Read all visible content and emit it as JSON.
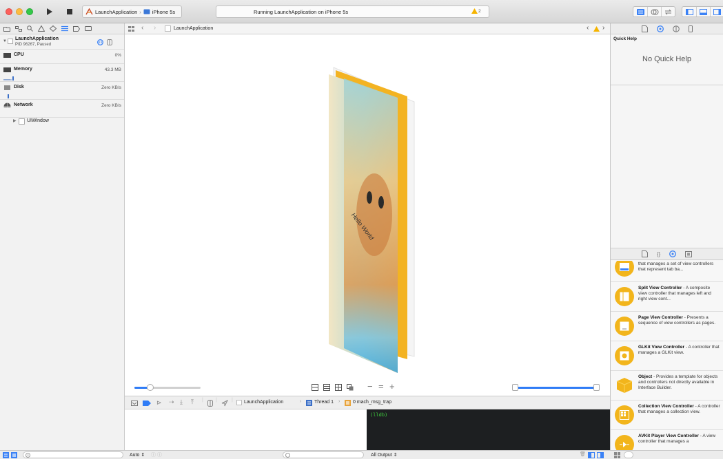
{
  "toolbar": {
    "scheme_name": "LaunchApplication",
    "device_name": "iPhone 5s",
    "activity_status": "Running LaunchApplication on iPhone 5s",
    "warning_count": "2"
  },
  "navigator": {
    "process_name": "LaunchApplication",
    "process_info": "PID 96267, Paused",
    "gauges": [
      {
        "label": "CPU",
        "value": "0%"
      },
      {
        "label": "Memory",
        "value": "43.3 MB"
      },
      {
        "label": "Disk",
        "value": "Zero KB/s"
      },
      {
        "label": "Network",
        "value": "Zero KB/s"
      }
    ],
    "tree_item": "UIWindow"
  },
  "jumpbar": {
    "path_item": "LaunchApplication"
  },
  "canvas": {
    "label_text": "Hello World"
  },
  "inspector": {
    "quick_help_title": "Quick Help",
    "quick_help_empty": "No Quick Help",
    "library_items": [
      {
        "title": "",
        "desc": "that manages a set of view controllers that represent tab ba..."
      },
      {
        "title": "Split View Controller",
        "desc": " - A composite view controller that manages left and right view cont..."
      },
      {
        "title": "Page View Controller",
        "desc": " - Presents a sequence of view controllers as pages."
      },
      {
        "title": "GLKit View Controller",
        "desc": " - A controller that manages a GLKit view."
      },
      {
        "title": "Object",
        "desc": " - Provides a template for objects and controllers not directly available in Interface Builder."
      },
      {
        "title": "Collection View Controller",
        "desc": " - A controller that manages a collection view."
      },
      {
        "title": "AVKit Player View Controller",
        "desc": " - A view controller that manages a"
      }
    ]
  },
  "debug": {
    "breadcrumb_app": "LaunchApplication",
    "breadcrumb_thread": "Thread 1",
    "breadcrumb_frame": "0 mach_msg_trap",
    "console_prompt": "(lldb)",
    "auto_label": "Auto",
    "output_label": "All Output"
  },
  "colors": {
    "accent": "#2f7cf6",
    "library_icon": "#f2b51c",
    "console_bg": "#1d1f21",
    "console_text": "#3fd33f"
  }
}
